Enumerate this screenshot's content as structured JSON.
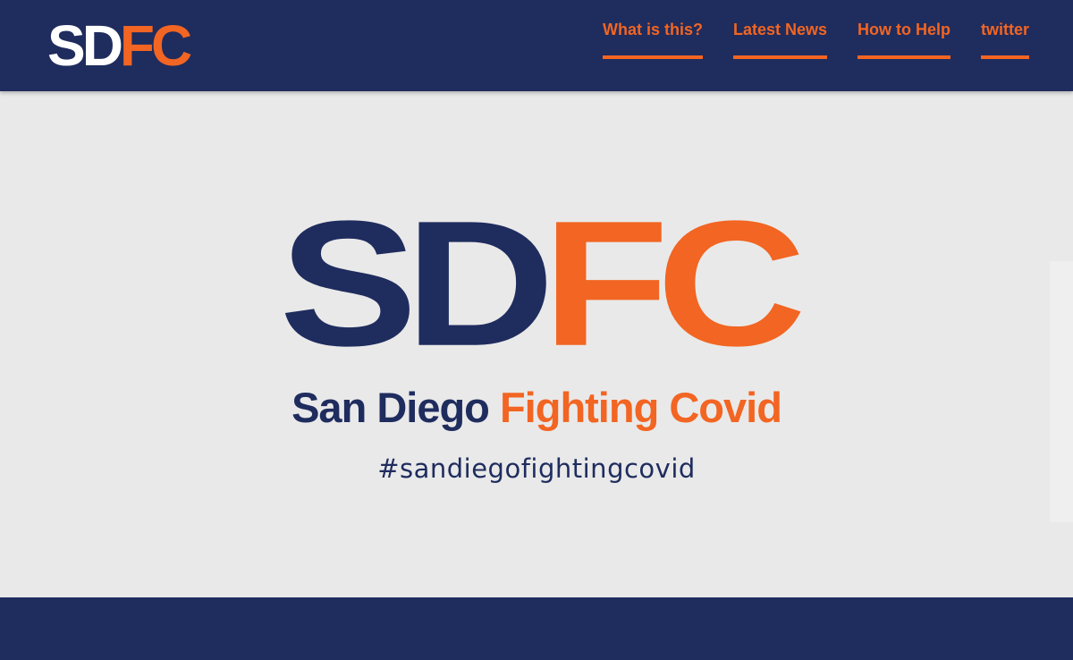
{
  "header": {
    "logo": {
      "sd": "SD",
      "fc": "FC"
    },
    "nav": [
      {
        "label": "What is this?"
      },
      {
        "label": "Latest News"
      },
      {
        "label": "How to Help"
      },
      {
        "label": "twitter"
      }
    ]
  },
  "hero": {
    "logo": {
      "sd": "SD",
      "fc": "FC"
    },
    "tagline": {
      "part1": "San Diego",
      "part2": "Fighting Covid"
    },
    "hashtag": "#sandiegofightingcovid"
  },
  "colors": {
    "navy": "#1f2c5e",
    "orange": "#f26522",
    "background": "#e9e9e9"
  }
}
